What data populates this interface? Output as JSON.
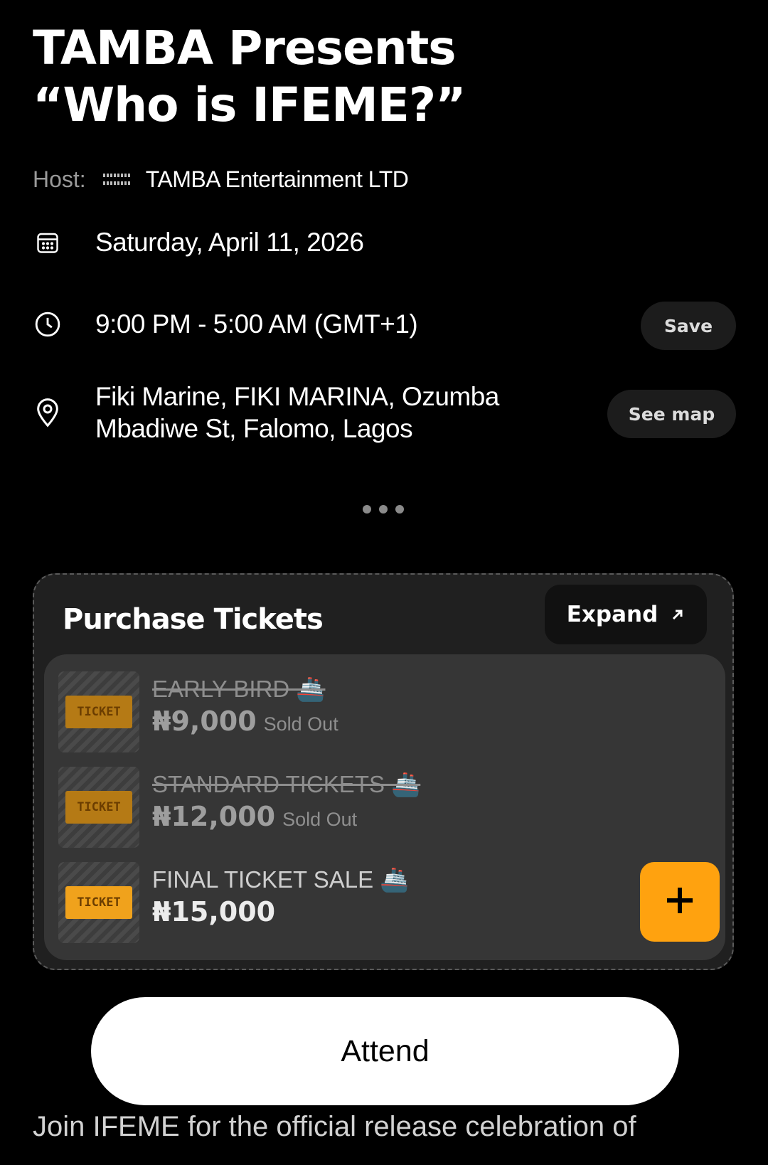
{
  "event": {
    "title_line1": "TAMBA Presents",
    "title_line2": "“Who is IFEME?”",
    "host_label": "Host:",
    "host_name": "TAMBA Entertainment LTD",
    "host_logo_text": "TAMBA",
    "date": "Saturday, April 11, 2026",
    "time": "9:00 PM - 5:00 AM (GMT+1)",
    "location_line1": "Fiki Marine, FIKI MARINA, Ozumba",
    "location_line2": "Mbadiwe St, Falomo, Lagos",
    "save_label": "Save",
    "see_map_label": "See map"
  },
  "icons": {
    "calendar": "calendar-icon",
    "clock": "clock-icon",
    "location": "location-pin-icon",
    "expand": "arrow-up-right-icon",
    "add": "plus-icon",
    "more": "more-dots-icon"
  },
  "tickets": {
    "heading": "Purchase Tickets",
    "expand_label": "Expand",
    "thumb_text": "TICKET",
    "items": [
      {
        "name": "EARLY BIRD 🚢",
        "price": "₦9,000",
        "status": "Sold Out"
      },
      {
        "name": "STANDARD TICKETS 🚢",
        "price": "₦12,000",
        "status": "Sold Out"
      },
      {
        "name": "FINAL TICKET SALE 🚢",
        "price": "₦15,000"
      }
    ]
  },
  "attend_label": "Attend",
  "description_preview": "Join IFEME for the official release celebration of",
  "colors": {
    "background": "#000000",
    "accent": "#FFA20F",
    "card": "#202020",
    "ticket_list": "#363636"
  }
}
